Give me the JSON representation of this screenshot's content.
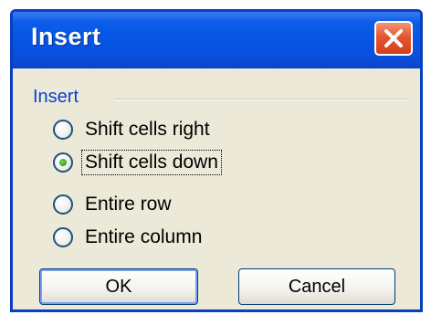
{
  "window": {
    "title": "Insert",
    "close_icon": "close-icon"
  },
  "group": {
    "label": "Insert"
  },
  "options": [
    {
      "label": "Shift cells right",
      "checked": false
    },
    {
      "label": "Shift cells down",
      "checked": true
    },
    {
      "label": "Entire row",
      "checked": false
    },
    {
      "label": "Entire column",
      "checked": false
    }
  ],
  "buttons": {
    "ok_label": "OK",
    "cancel_label": "Cancel"
  },
  "colors": {
    "titlebar": "#0654e3",
    "dialog_background": "#ece9d8",
    "group_label": "#0a3fd1",
    "close_button": "#e4562f",
    "radio_selected": "#2da51a"
  }
}
